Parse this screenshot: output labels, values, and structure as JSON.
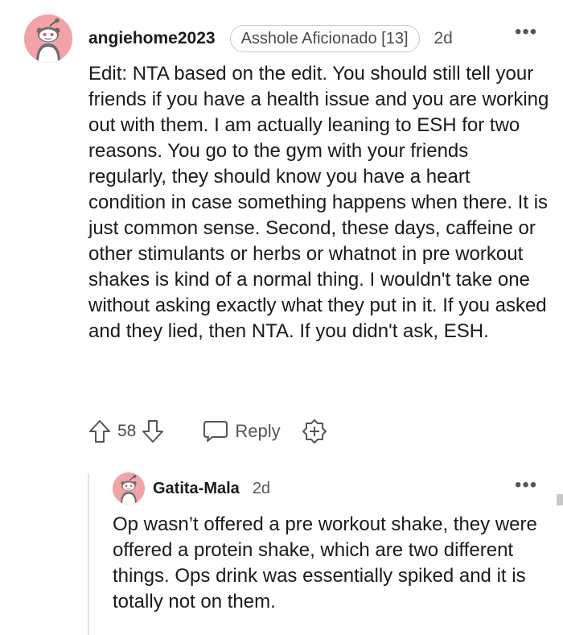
{
  "comment": {
    "username": "angiehome2023",
    "flair": "Asshole Aficionado [13]",
    "timestamp": "2d",
    "more": "•••",
    "body": "Edit: NTA based on the edit. You should still tell your friends if you have a health issue and you are working out with them. I am actually leaning to ESH for two reasons. You go to the gym with your friends regularly, they should know you have a heart condition in case something happens when there. It is just common sense. Second, these days, caffeine or other stimulants or herbs or whatnot in pre workout shakes is kind of a normal thing. I wouldn't take one without asking exactly what they put in it. If you asked and they lied, then NTA. If you didn't ask, ESH.",
    "actions": {
      "vote_count": "58",
      "reply_label": "Reply"
    }
  },
  "reply": {
    "username": "Gatita-Mala",
    "timestamp": "2d",
    "more": "•••",
    "body": "Op wasn’t offered a pre workout shake, they were offered a protein shake, which are two different things. Ops drink was essentially spiked and it is totally not on them."
  },
  "icons": {
    "avatar": "snoo-avatar-icon",
    "upvote": "upvote-arrow-icon",
    "downvote": "downvote-arrow-icon",
    "reply": "speech-bubble-icon",
    "award": "award-plus-icon",
    "more": "more-dots-icon"
  },
  "colors": {
    "avatar_bg": "#f2a3a8",
    "text": "#1a1a1b",
    "muted": "#555555",
    "thread_line": "#e2e2e2"
  }
}
